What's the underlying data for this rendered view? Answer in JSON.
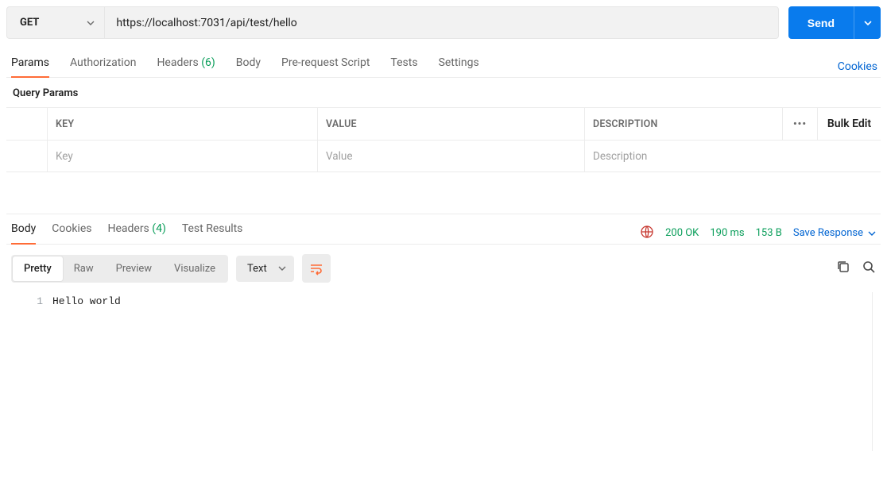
{
  "request": {
    "method": "GET",
    "url": "https://localhost:7031/api/test/hello",
    "send_label": "Send"
  },
  "tabs": {
    "params": "Params",
    "authorization": "Authorization",
    "headers": "Headers",
    "headers_count": "(6)",
    "body": "Body",
    "prerequest": "Pre-request Script",
    "tests": "Tests",
    "settings": "Settings",
    "cookies_link": "Cookies"
  },
  "query_params": {
    "section_label": "Query Params",
    "header_key": "KEY",
    "header_value": "VALUE",
    "header_desc": "DESCRIPTION",
    "bulk_edit": "Bulk Edit",
    "placeholder_key": "Key",
    "placeholder_value": "Value",
    "placeholder_desc": "Description"
  },
  "response": {
    "tabs": {
      "body": "Body",
      "cookies": "Cookies",
      "headers": "Headers",
      "headers_count": "(4)",
      "test_results": "Test Results"
    },
    "status_code": "200 OK",
    "time": "190 ms",
    "size": "153 B",
    "save_response": "Save Response",
    "view": {
      "pretty": "Pretty",
      "raw": "Raw",
      "preview": "Preview",
      "visualize": "Visualize"
    },
    "format": "Text",
    "body_line_no": "1",
    "body_text": "Hello world"
  }
}
